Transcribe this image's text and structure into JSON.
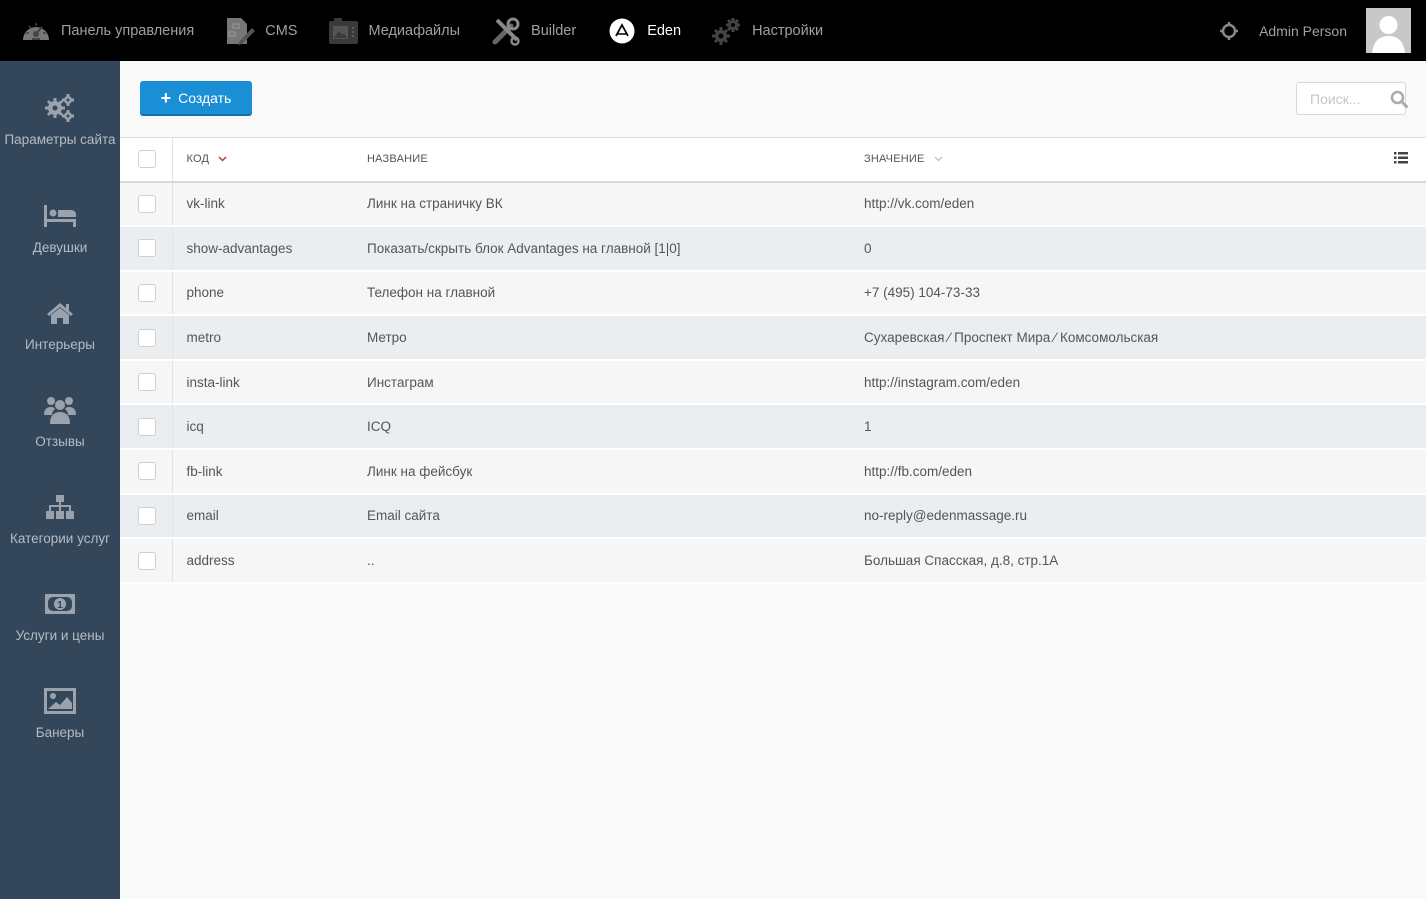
{
  "topnav": {
    "items": [
      {
        "label": "Панель управления",
        "icon": "dashboard-gauge-icon",
        "active": false
      },
      {
        "label": "CMS",
        "icon": "cms-document-edit-icon",
        "active": false
      },
      {
        "label": "Медиафайлы",
        "icon": "media-camera-icon",
        "active": false
      },
      {
        "label": "Builder",
        "icon": "builder-tools-icon",
        "active": false
      },
      {
        "label": "Eden",
        "icon": "eden-logo-icon",
        "active": true
      },
      {
        "label": "Настройки",
        "icon": "settings-gears-icon",
        "active": false
      }
    ],
    "user_name": "Admin Person"
  },
  "sidebar": {
    "items": [
      {
        "label": "Параметры сайта",
        "icon": "cogs-icon"
      },
      {
        "label": "Девушки",
        "icon": "bed-icon"
      },
      {
        "label": "Интерьеры",
        "icon": "home-icon"
      },
      {
        "label": "Отзывы",
        "icon": "users-icon"
      },
      {
        "label": "Категории услуг",
        "icon": "sitemap-icon"
      },
      {
        "label": "Услуги и цены",
        "icon": "money-icon"
      },
      {
        "label": "Банеры",
        "icon": "image-icon"
      }
    ]
  },
  "toolbar": {
    "create_label": "Создать",
    "search_placeholder": "Поиск..."
  },
  "table": {
    "columns": {
      "code": "Код",
      "name": "Название",
      "value": "Значение"
    },
    "sort_column": "code",
    "rows": [
      {
        "code": "vk-link",
        "name": "Линк на страничку ВК",
        "value": "http://vk.com/eden"
      },
      {
        "code": "show-advantages",
        "name": "Показать/скрыть блок Advantages на главной [1|0]",
        "value": "0"
      },
      {
        "code": "phone",
        "name": "Телефон на главной",
        "value": "+7 (495) 104-73-33"
      },
      {
        "code": "metro",
        "name": "Метро",
        "value": "Сухаревская ⁄ Проспект Мира ⁄ Комсомольская"
      },
      {
        "code": "insta-link",
        "name": "Инстаграм",
        "value": "http://instagram.com/eden"
      },
      {
        "code": "icq",
        "name": "ICQ",
        "value": "1"
      },
      {
        "code": "fb-link",
        "name": "Линк на фейсбук",
        "value": "http://fb.com/eden"
      },
      {
        "code": "email",
        "name": "Email сайта",
        "value": "no-reply@edenmassage.ru"
      },
      {
        "code": "address",
        "name": "..",
        "value": "Большая Спасская, д.8, стр.1А"
      }
    ]
  },
  "colors": {
    "topbar": "#000000",
    "sidebar": "#34465a",
    "accent": "#1b8fd6",
    "sort_active": "#c0392b"
  }
}
